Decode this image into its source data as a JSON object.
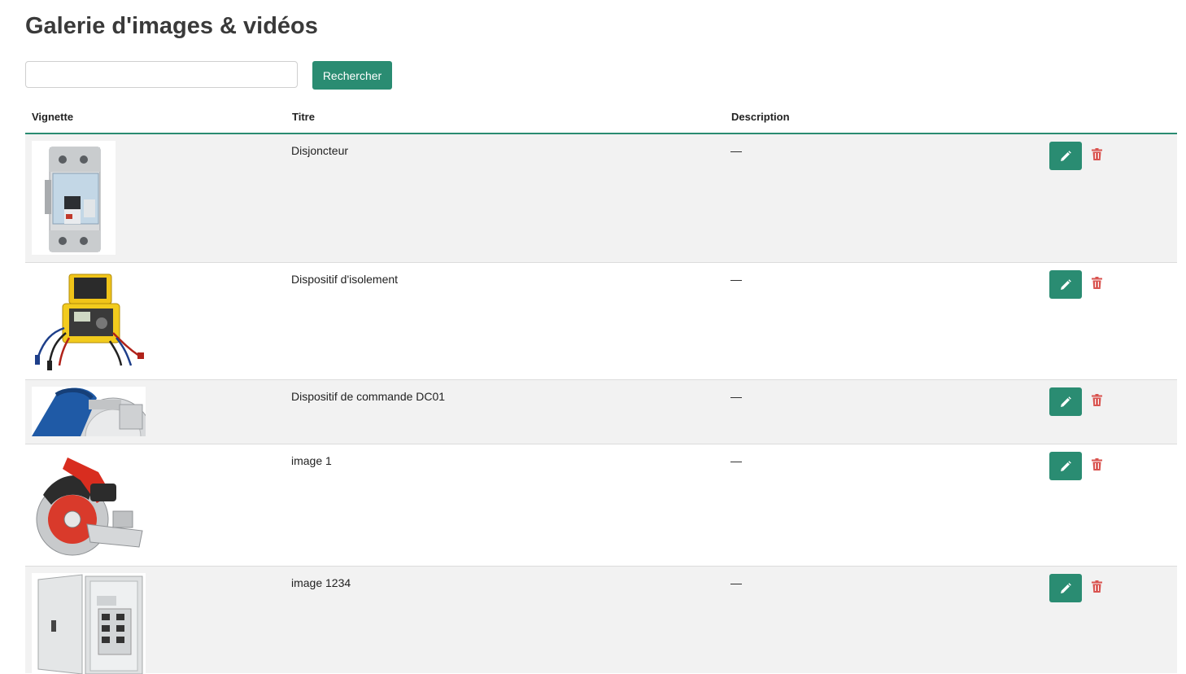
{
  "page": {
    "title": "Galerie d'images & vidéos"
  },
  "search": {
    "value": "",
    "placeholder": "",
    "button_label": "Rechercher"
  },
  "table": {
    "headers": {
      "thumbnail": "Vignette",
      "title": "Titre",
      "description": "Description"
    },
    "rows": [
      {
        "title": "Disjoncteur",
        "description": "—",
        "thumbnail_icon": "circuit-breaker-image"
      },
      {
        "title": "Dispositif d'isolement",
        "description": "—",
        "thumbnail_icon": "insulation-tester-image"
      },
      {
        "title": "Dispositif de commande DC01",
        "description": "—",
        "thumbnail_icon": "circular-saw-cropped-image"
      },
      {
        "title": "image 1",
        "description": "—",
        "thumbnail_icon": "circular-saw-image"
      },
      {
        "title": "image 1234",
        "description": "—",
        "thumbnail_icon": "electrical-panel-image"
      }
    ],
    "row_actions": {
      "edit_icon": "pencil-icon",
      "delete_icon": "trash-icon"
    }
  },
  "colors": {
    "accent": "#2a8c72",
    "danger": "#d9534f",
    "row_shade": "#f2f2f2"
  }
}
